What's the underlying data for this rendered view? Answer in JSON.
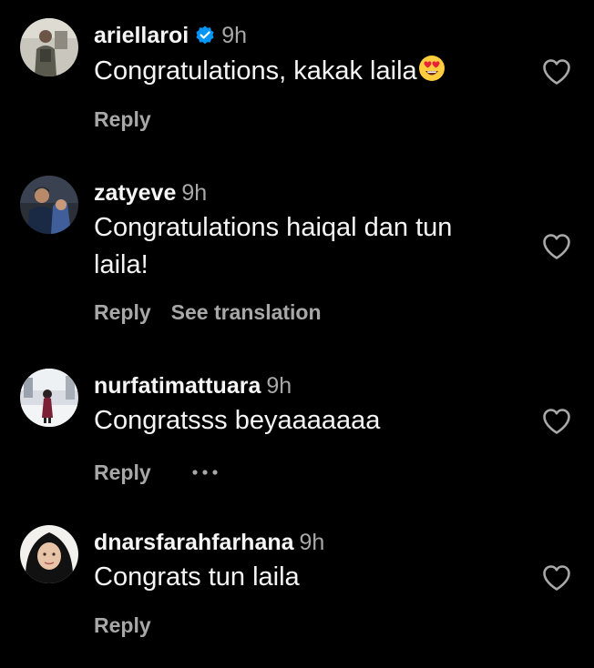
{
  "comments": [
    {
      "username": "ariellaroi",
      "verified": true,
      "time": "9h",
      "text": "Congratulations, kakak laila",
      "emoji": "heart-eyes-emoji",
      "reply_label": "Reply"
    },
    {
      "username": "zatyeve",
      "verified": false,
      "time": "9h",
      "text": "Congratulations haiqal dan tun laila!",
      "reply_label": "Reply",
      "translation_label": "See translation"
    },
    {
      "username": "nurfatimattuara",
      "verified": false,
      "time": "9h",
      "text": "Congratsss beyaaaaaaa",
      "reply_label": "Reply",
      "more_icon": "more-options-icon"
    },
    {
      "username": "dnarsfarahfarhana",
      "verified": false,
      "time": "9h",
      "text": "Congrats tun laila",
      "reply_label": "Reply"
    }
  ],
  "icons": {
    "like": "heart-outline-icon",
    "verified": "verified-badge-icon"
  },
  "colors": {
    "background": "#000000",
    "primary_text": "#f5f5f5",
    "secondary_text": "#a8a8a8",
    "verified_blue": "#0095f6"
  }
}
